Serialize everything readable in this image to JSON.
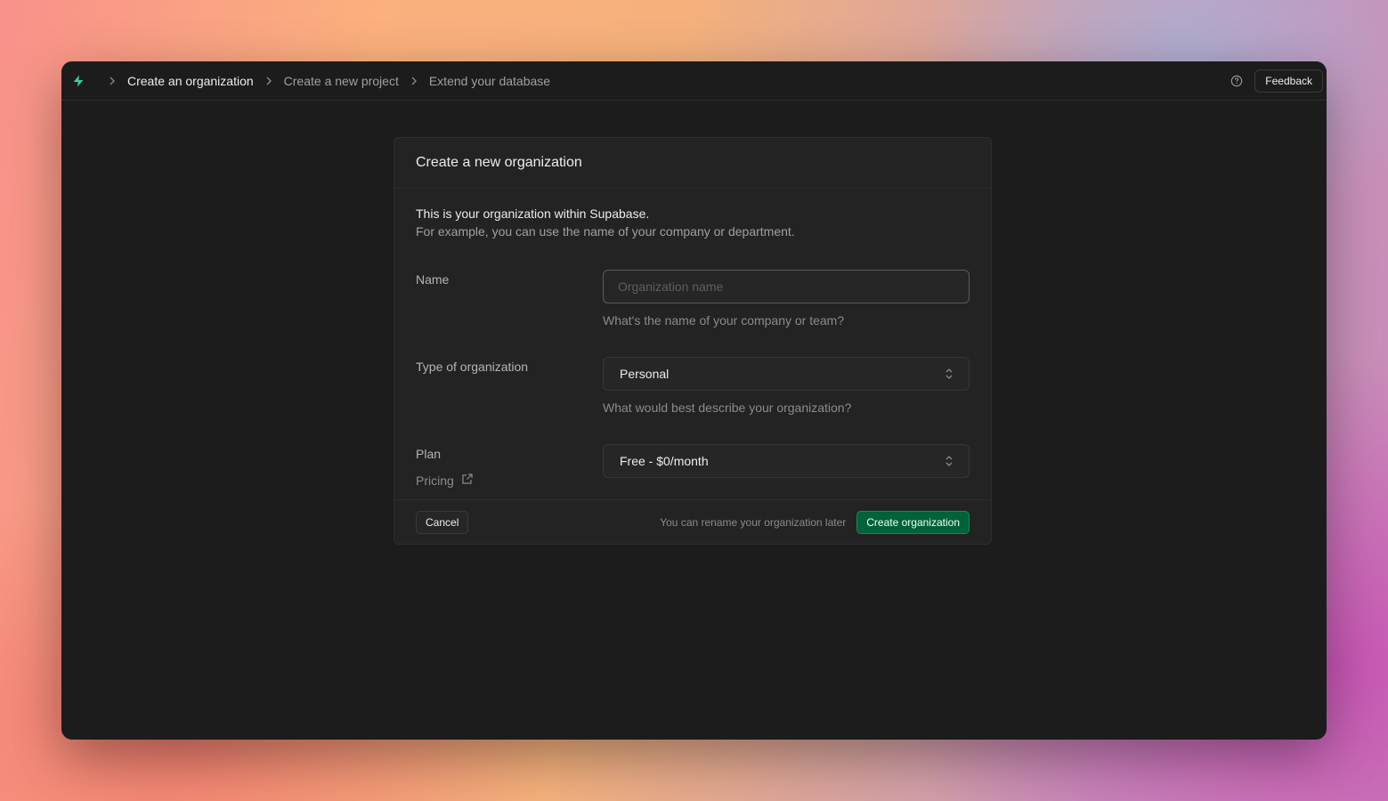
{
  "breadcrumbs": [
    {
      "label": "Create an organization",
      "active": true
    },
    {
      "label": "Create a new project",
      "active": false
    },
    {
      "label": "Extend your database",
      "active": false
    }
  ],
  "topbar": {
    "help_icon": "help-circle-icon",
    "feedback_label": "Feedback"
  },
  "card": {
    "title": "Create a new organization",
    "intro_line1": "This is your organization within Supabase.",
    "intro_line2": "For example, you can use the name of your company or department.",
    "name": {
      "label": "Name",
      "value": "",
      "placeholder": "Organization name",
      "hint": "What's the name of your company or team?"
    },
    "org_type": {
      "label": "Type of organization",
      "value": "Personal",
      "hint": "What would best describe your organization?"
    },
    "plan": {
      "label": "Plan",
      "pricing_label": "Pricing",
      "value": "Free - $0/month"
    },
    "footer": {
      "cancel_label": "Cancel",
      "note": "You can rename your organization later",
      "create_label": "Create organization"
    }
  },
  "colors": {
    "brand_green": "#3ecf8e",
    "create_button": "#006239",
    "window_bg": "#1c1c1c"
  }
}
